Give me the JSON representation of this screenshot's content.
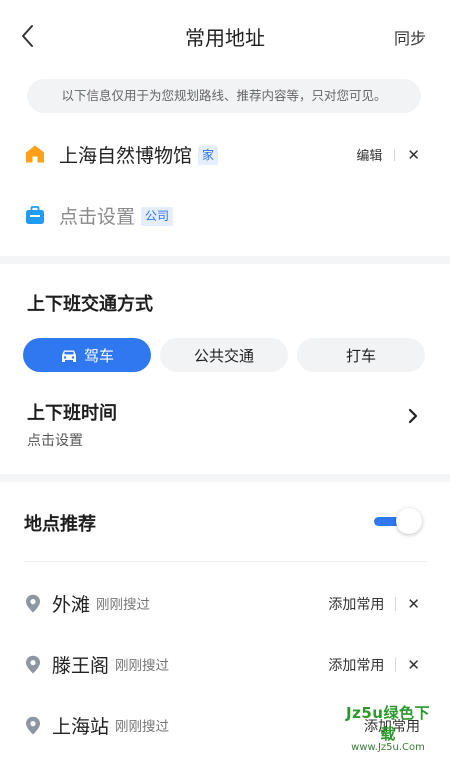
{
  "header": {
    "title": "常用地址",
    "sync_label": "同步"
  },
  "notice": "以下信息仅用于为您规划路线、推荐内容等，只对您可见。",
  "addresses": [
    {
      "name": "上海自然博物馆",
      "tag": "家",
      "icon": "home-icon",
      "icon_color": "#ff9f1a",
      "edit_label": "编辑"
    },
    {
      "name": "点击设置",
      "tag": "公司",
      "icon": "briefcase-icon",
      "icon_color": "#1f9df5"
    }
  ],
  "commute": {
    "title": "上下班交通方式",
    "modes": [
      {
        "label": "驾车",
        "active": true,
        "icon": "car-icon"
      },
      {
        "label": "公共交通",
        "active": false
      },
      {
        "label": "打车",
        "active": false
      }
    ],
    "time_title": "上下班时间",
    "time_value": "点击设置"
  },
  "recommend": {
    "title": "地点推荐",
    "toggle_on": true,
    "items": [
      {
        "name": "外滩",
        "note": "刚刚搜过",
        "action_label": "添加常用"
      },
      {
        "name": "滕王阁",
        "note": "刚刚搜过",
        "action_label": "添加常用"
      },
      {
        "name": "上海站",
        "note": "刚刚搜过",
        "action_label": "添加常用"
      }
    ]
  },
  "watermark": {
    "main": "Jz5u绿色下载",
    "sub": "www.Jz5u.Com"
  },
  "colors": {
    "accent": "#2f78f0",
    "tag_bg": "#e4eeff",
    "band": "#f4f5f7"
  }
}
